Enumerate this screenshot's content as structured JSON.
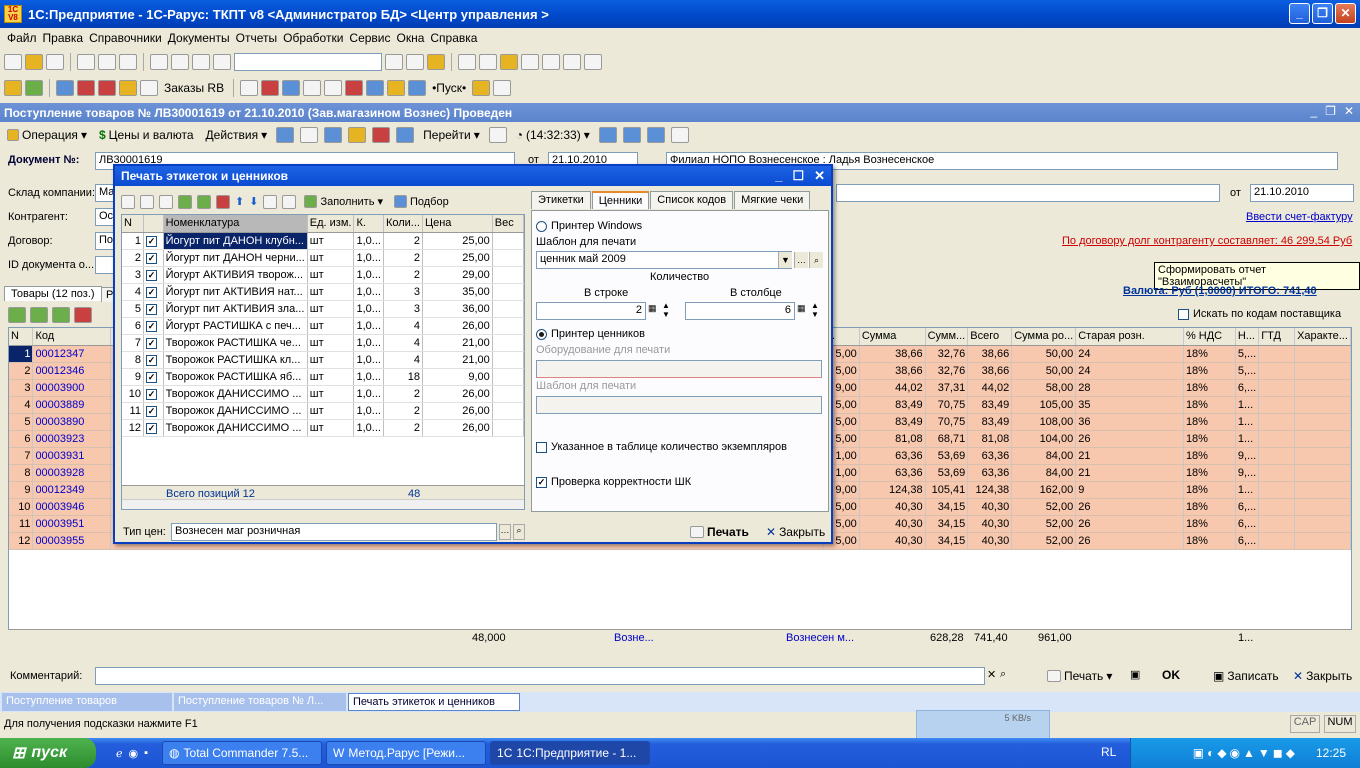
{
  "app": {
    "title": "1С:Предприятие - 1С-Рарус: ТКПТ v8 <Администратор БД> <Центр управления >",
    "icon_text": "1C V8"
  },
  "menu": [
    "Файл",
    "Правка",
    "Справочники",
    "Документы",
    "Отчеты",
    "Обработки",
    "Сервис",
    "Окна",
    "Справка"
  ],
  "toolbar2": {
    "orders": "Заказы RB",
    "run": "•Пуск•"
  },
  "doc": {
    "title": "Поступление товаров № ЛВ30001619 от 21.10.2010 (Зав.магазином Вознес) Проведен",
    "bar": {
      "operation": "Операция",
      "prices": "Цены и валюта",
      "actions": "Действия",
      "time": "(14:32:33)",
      "goto": "Перейти"
    },
    "doc_no_label": "Документ №:",
    "doc_no": "ЛВ30001619",
    "from_label": "от",
    "date": "21.10.2010",
    "branch": "Филиал НОПО Вознесенское   : Ладья Вознесенское",
    "warehouse_label": "Склад компании:",
    "warehouse": "Ма",
    "contractor_label": "Контрагент:",
    "contractor": "Ос",
    "contract_label": "Договор:",
    "contract": "По",
    "docid_label": "ID документа о...",
    "from2": "от",
    "date2": "21.10.2010",
    "invoice_link": "Ввести счет-фактуру",
    "debt_link": "По договору долг контрагенту составляет: 46 299,54 Руб",
    "tooltip": "Сформировать отчет \"Взаиморасчеты\"",
    "currency_total": "Валюта: Руб (1,0000)    ИТОГО: 741,40",
    "tab_goods": "Товары (12 поз.)",
    "tab_r": "Р",
    "search_supplier": "Искать по кодам поставщика"
  },
  "grid": {
    "headers": [
      "N",
      "Код",
      "н.",
      "Сумма",
      "Сумм...",
      "Всего",
      "Сумма ро...",
      "Старая розн.",
      "% НДС",
      "Н...",
      "ГТД",
      "Характе..."
    ],
    "rows": [
      {
        "n": "1",
        "code": "00012347",
        "p": "5,00",
        "sum": "38,66",
        "s2": "32,76",
        "total": "38,66",
        "rsum": "50,00",
        "old": "24",
        "vat": "18%",
        "h": "5,..."
      },
      {
        "n": "2",
        "code": "00012346",
        "p": "5,00",
        "sum": "38,66",
        "s2": "32,76",
        "total": "38,66",
        "rsum": "50,00",
        "old": "24",
        "vat": "18%",
        "h": "5,..."
      },
      {
        "n": "3",
        "code": "00003900",
        "p": "9,00",
        "sum": "44,02",
        "s2": "37,31",
        "total": "44,02",
        "rsum": "58,00",
        "old": "28",
        "vat": "18%",
        "h": "6,..."
      },
      {
        "n": "4",
        "code": "00003889",
        "p": "5,00",
        "sum": "83,49",
        "s2": "70,75",
        "total": "83,49",
        "rsum": "105,00",
        "old": "35",
        "vat": "18%",
        "h": "1..."
      },
      {
        "n": "5",
        "code": "00003890",
        "p": "5,00",
        "sum": "83,49",
        "s2": "70,75",
        "total": "83,49",
        "rsum": "108,00",
        "old": "36",
        "vat": "18%",
        "h": "1..."
      },
      {
        "n": "6",
        "code": "00003923",
        "p": "5,00",
        "sum": "81,08",
        "s2": "68,71",
        "total": "81,08",
        "rsum": "104,00",
        "old": "26",
        "vat": "18%",
        "h": "1..."
      },
      {
        "n": "7",
        "code": "00003931",
        "p": "1,00",
        "sum": "63,36",
        "s2": "53,69",
        "total": "63,36",
        "rsum": "84,00",
        "old": "21",
        "vat": "18%",
        "h": "9,..."
      },
      {
        "n": "8",
        "code": "00003928",
        "p": "1,00",
        "sum": "63,36",
        "s2": "53,69",
        "total": "63,36",
        "rsum": "84,00",
        "old": "21",
        "vat": "18%",
        "h": "9,..."
      },
      {
        "n": "9",
        "code": "00012349",
        "p": "9,00",
        "sum": "124,38",
        "s2": "105,41",
        "total": "124,38",
        "rsum": "162,00",
        "old": "9",
        "vat": "18%",
        "h": "1..."
      },
      {
        "n": "10",
        "code": "00003946",
        "p": "5,00",
        "sum": "40,30",
        "s2": "34,15",
        "total": "40,30",
        "rsum": "52,00",
        "old": "26",
        "vat": "18%",
        "h": "6,..."
      },
      {
        "n": "11",
        "code": "00003951",
        "p": "5,00",
        "sum": "40,30",
        "s2": "34,15",
        "total": "40,30",
        "rsum": "52,00",
        "old": "26",
        "vat": "18%",
        "h": "6,..."
      },
      {
        "n": "12",
        "code": "00003955",
        "p": "5,00",
        "sum": "40,30",
        "s2": "34,15",
        "total": "40,30",
        "rsum": "52,00",
        "old": "26",
        "vat": "18%",
        "h": "6,..."
      }
    ],
    "totals": {
      "qty": "48,000",
      "store": "Возне...",
      "store2": "Вознесен м...",
      "s2": "628,28",
      "total": "741,40",
      "rsum": "961,00",
      "h": "1..."
    }
  },
  "footer": {
    "comment_label": "Комментарий:",
    "print": "Печать",
    "ok": "OK",
    "save": "Записать",
    "close": "Закрыть"
  },
  "windows": [
    "Поступление товаров",
    "Поступление товаров № Л...",
    "Печать этикеток и ценников"
  ],
  "status": {
    "hint": "Для получения подсказки нажмите F1",
    "caps": "CAP",
    "num": "NUM",
    "speed": "5 KB/s"
  },
  "dialog": {
    "title": "Печать этикеток и ценников",
    "fill": "Заполнить",
    "pick": "Подбор",
    "headers": [
      "N",
      "",
      "Номенклатура",
      "Ед. изм.",
      "К.",
      "Коли...",
      "Цена",
      "Вес"
    ],
    "rows": [
      {
        "n": "1",
        "name": "Йогурт пит ДАНОН клубн...",
        "unit": "шт",
        "k": "1,0...",
        "qty": "2",
        "price": "25,00"
      },
      {
        "n": "2",
        "name": "Йогурт пит ДАНОН черни...",
        "unit": "шт",
        "k": "1,0...",
        "qty": "2",
        "price": "25,00"
      },
      {
        "n": "3",
        "name": "Йогурт АКТИВИЯ творож...",
        "unit": "шт",
        "k": "1,0...",
        "qty": "2",
        "price": "29,00"
      },
      {
        "n": "4",
        "name": "Йогурт пит АКТИВИЯ нат...",
        "unit": "шт",
        "k": "1,0...",
        "qty": "3",
        "price": "35,00"
      },
      {
        "n": "5",
        "name": "Йогурт пит АКТИВИЯ зла...",
        "unit": "шт",
        "k": "1,0...",
        "qty": "3",
        "price": "36,00"
      },
      {
        "n": "6",
        "name": "Йогурт РАСТИШКА с печ...",
        "unit": "шт",
        "k": "1,0...",
        "qty": "4",
        "price": "26,00"
      },
      {
        "n": "7",
        "name": "Творожок РАСТИШКА че...",
        "unit": "шт",
        "k": "1,0...",
        "qty": "4",
        "price": "21,00"
      },
      {
        "n": "8",
        "name": "Творожок РАСТИШКА кл...",
        "unit": "шт",
        "k": "1,0...",
        "qty": "4",
        "price": "21,00"
      },
      {
        "n": "9",
        "name": "Творожок РАСТИШКА яб...",
        "unit": "шт",
        "k": "1,0...",
        "qty": "18",
        "price": "9,00"
      },
      {
        "n": "10",
        "name": "Творожок ДАНИССИМО ...",
        "unit": "шт",
        "k": "1,0...",
        "qty": "2",
        "price": "26,00"
      },
      {
        "n": "11",
        "name": "Творожок ДАНИССИМО ...",
        "unit": "шт",
        "k": "1,0...",
        "qty": "2",
        "price": "26,00"
      },
      {
        "n": "12",
        "name": "Творожок ДАНИССИМО ...",
        "unit": "шт",
        "k": "1,0...",
        "qty": "2",
        "price": "26,00"
      }
    ],
    "total_label": "Всего позиций 12",
    "total_qty": "48",
    "price_type_label": "Тип цен:",
    "price_type": "Вознесен маг розничная",
    "print": "Печать",
    "close": "Закрыть",
    "tabs": [
      "Этикетки",
      "Ценники",
      "Список кодов",
      "Мягкие чеки"
    ],
    "printer_windows": "Принтер Windows",
    "template_label": "Шаблон для печати",
    "template": "ценник май 2009",
    "qty_label": "Количество",
    "in_row": "В строке",
    "in_col": "В столбце",
    "row_val": "2",
    "col_val": "6",
    "price_printer": "Принтер ценников",
    "equipment_label": "Оборудование для печати",
    "template_label2": "Шаблон для печати",
    "copies_label": "Указанное в таблице количество экземпляров",
    "barcode_label": "Проверка корректности ШК"
  },
  "taskbar": {
    "start": "пуск",
    "tasks": [
      "Total Commander 7.5...",
      "Метод.Рарус [Режи...",
      "1С:Предприятие - 1..."
    ],
    "lang": "RL",
    "clock": "12:25"
  }
}
